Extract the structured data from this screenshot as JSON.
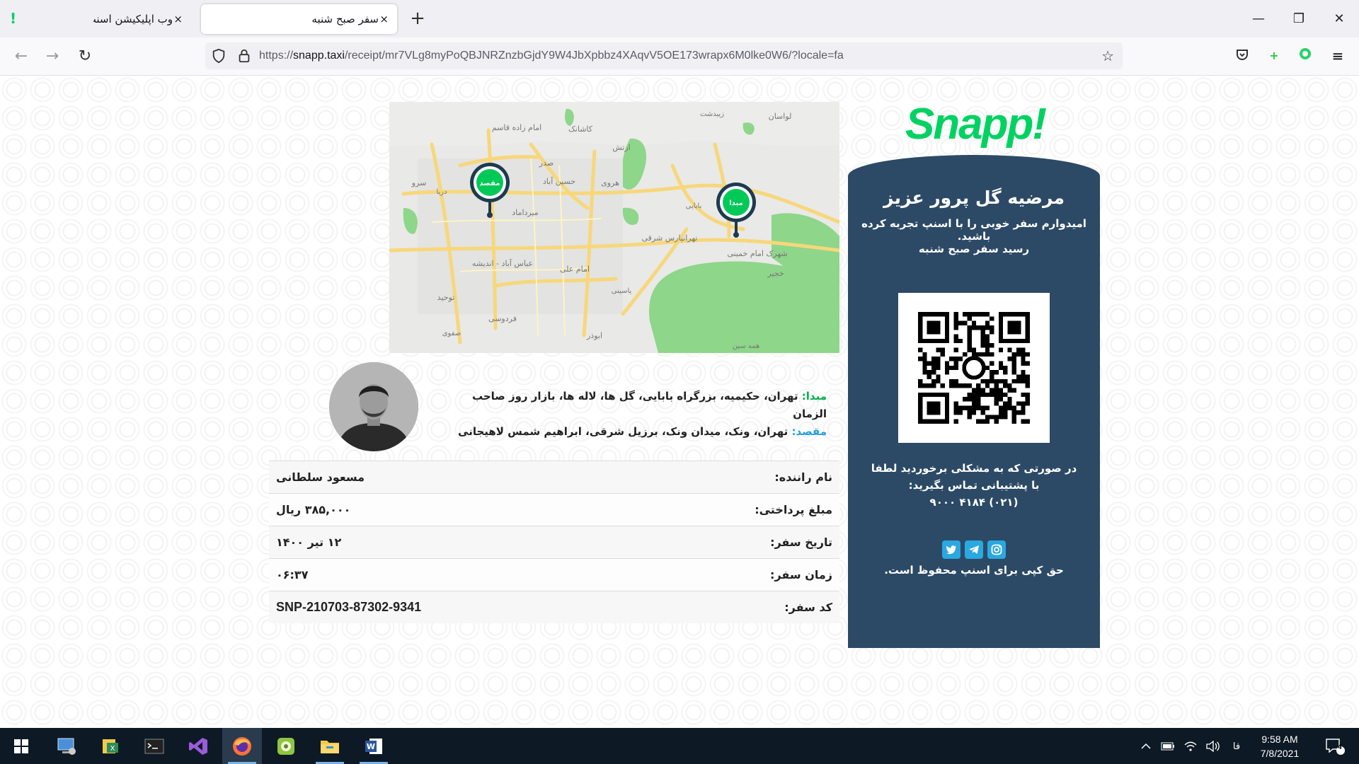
{
  "browser": {
    "tabs": [
      {
        "title": "وب اپلیکیشن اسنپ",
        "active": false
      },
      {
        "title": "سفر صبح شنبه",
        "active": true
      }
    ],
    "url_prefix": "https://",
    "url_domain": "snapp.taxi",
    "url_rest": "/receipt/mr7VLg8myPoQBJNRZnzbGjdY9W4JbXpbbz4XAqvV5OE173wrapx6M0lke0W6/?locale=fa",
    "close_glyph": "×",
    "new_tab_glyph": "+",
    "window_controls": {
      "minimize": "—",
      "restore": "❐",
      "close": "✕"
    }
  },
  "receipt": {
    "brand": "Snapp!",
    "greeting": "مرضیه گل پرور عزیز",
    "subtitle": "امیدوارم سفر خوبی را با اسنپ تجربه کرده باشید.",
    "receipt_title": "رسید سفر صبح شنبه",
    "support_text": "در صورتی که به مشکلی برخوردید لطفا با پشتیبانی تماس بگیرید:",
    "support_phone": "(۰۲۱) ۴۱۸۴ ۹۰۰۰",
    "copyright": "حق کپی برای اسنپ محفوظ است.",
    "origin_label": "مبدا:",
    "origin": "تهران، حکیمیه، بزرگراه بابایی، گل ها، لاله ها، بازار روز صاحب الزمان",
    "destination_label": "مقصد:",
    "destination": "تهران، ونک، میدان ونک، برزیل شرقی، ابراهیم شمس لاهیجانی",
    "details": [
      {
        "key": "نام راننده:",
        "value": "مسعود سلطانی",
        "ltr": false
      },
      {
        "key": "مبلغ پرداختی:",
        "value": "۳۸۵,۰۰۰ ریال",
        "ltr": false
      },
      {
        "key": "تاریخ سفر:",
        "value": "۱۲ تیر ۱۴۰۰",
        "ltr": false
      },
      {
        "key": "زمان سفر:",
        "value": "۰۶:۳۷",
        "ltr": false
      },
      {
        "key": "کد سفر:",
        "value": "SNP-210703-87302-9341",
        "ltr": true
      }
    ]
  },
  "map": {
    "pin_origin": "مبدا",
    "pin_destination": "مقصد",
    "labels": [
      "لواسان",
      "زیبدشت",
      "کاشانک",
      "امام زاده قاسم",
      "ارتش",
      "صدر",
      "حسین آباد",
      "هروی",
      "سرو",
      "دریا",
      "میرداماد",
      "تهرانپارس شرقی",
      "شهرک امام خمینی",
      "خجیر",
      "عباس آباد - اندیشه",
      "امام علی",
      "توحید",
      "فردوسی",
      "صفوی",
      "ابوذر",
      "همه سین",
      "بابایی",
      "یاسینی"
    ]
  },
  "taskbar": {
    "tray_lang": "فا",
    "time": "9:58 AM",
    "date": "7/8/2021",
    "notification_count": "4"
  },
  "colors": {
    "brand_green": "#00d262",
    "card_bg": "#2c4a66",
    "origin_green": "#00b050",
    "dest_blue": "#1fa0d8"
  }
}
